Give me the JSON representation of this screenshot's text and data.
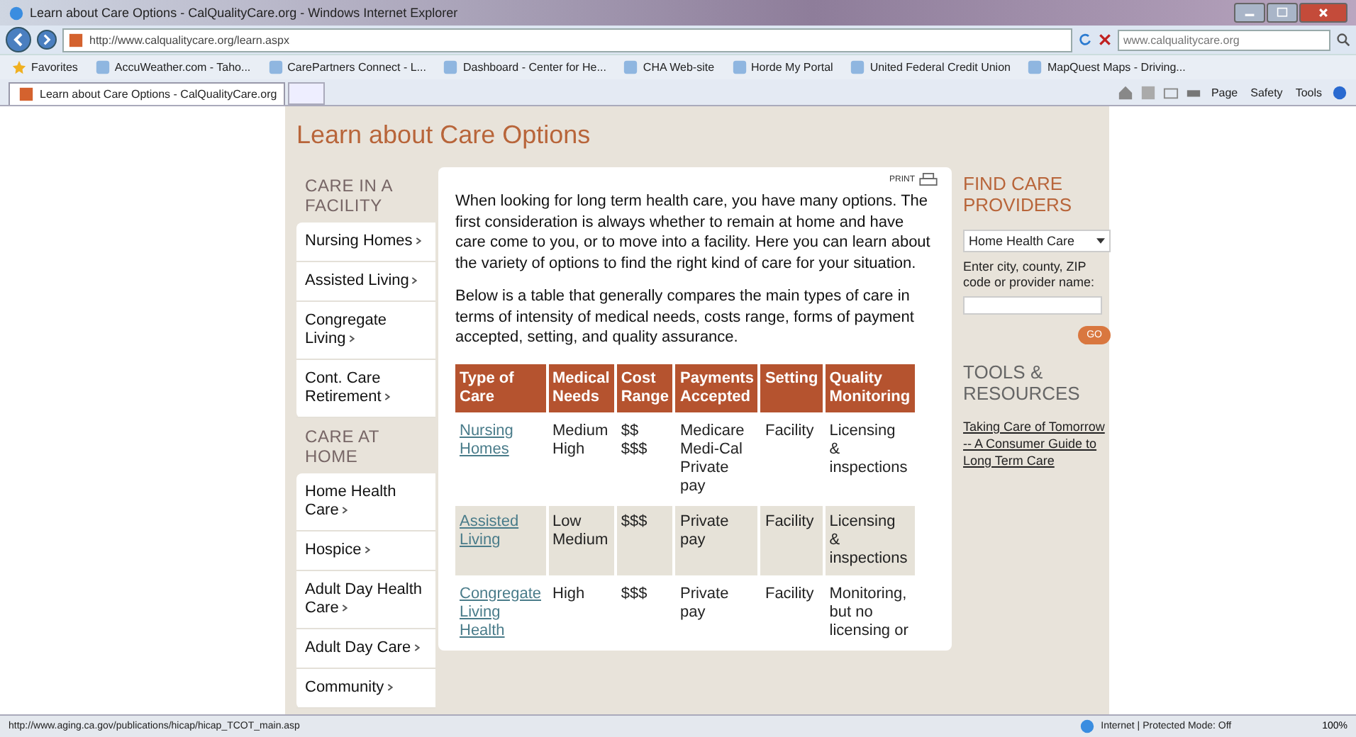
{
  "window": {
    "title": "Learn about Care Options - CalQualityCare.org - Windows Internet Explorer"
  },
  "address_bar": {
    "url": "http://www.calqualitycare.org/learn.aspx",
    "search_placeholder": "www.calqualitycare.org"
  },
  "favorites_bar": {
    "label": "Favorites",
    "items": [
      "AccuWeather.com - Taho...",
      "CarePartners Connect - L...",
      "Dashboard - Center for He...",
      "CHA Web-site",
      "Horde My Portal",
      "United Federal Credit Union",
      "MapQuest Maps - Driving..."
    ]
  },
  "tabs": [
    {
      "label": "Learn about Care Options - CalQualityCare.org",
      "selected": true
    }
  ],
  "command_bar": [
    "Page",
    "Safety",
    "Tools"
  ],
  "page": {
    "heading": "Learn about Care Options",
    "nav": [
      {
        "heading": "CARE IN A FACILITY",
        "items": [
          "Nursing Homes",
          "Assisted Living",
          "Congregate Living",
          "Cont. Care Retirement"
        ]
      },
      {
        "heading": "CARE AT HOME",
        "items": [
          "Home Health Care",
          "Hospice",
          "Adult Day Health Care",
          "Adult Day Care",
          "Community"
        ]
      }
    ],
    "print_label": "PRINT",
    "paragraphs": [
      "When looking for long term health care, you have many options. The first consideration is always whether to remain at home and have care come to you, or to move into a facility. Here you can learn about the variety of options to find the right kind of care for your situation.",
      "Below is a table that generally compares the main types of care in terms of intensity of medical needs, costs range, forms of payment accepted, setting, and quality assurance."
    ],
    "table": {
      "columns": [
        "Type of Care",
        "Medical Needs",
        "Cost Range",
        "Payments Accepted",
        "Setting",
        "Quality Monitoring"
      ],
      "rows": [
        {
          "type": "Nursing Homes",
          "medical": "Medium High",
          "cost": "$$ $$$",
          "payments": "Medicare Medi-Cal Private pay",
          "setting": "Facility",
          "quality": "Licensing & inspections"
        },
        {
          "type": "Assisted Living",
          "medical": "Low Medium",
          "cost": "$$$",
          "payments": "Private pay",
          "setting": "Facility",
          "quality": "Licensing & inspections"
        },
        {
          "type": "Congregate Living Health",
          "medical": "High",
          "cost": "$$$",
          "payments": "Private pay",
          "setting": "Facility",
          "quality": "Monitoring, but no licensing or"
        }
      ]
    },
    "find_care": {
      "heading": "FIND CARE PROVIDERS",
      "select": "Home Health Care",
      "field_label": "Enter city, county, ZIP code or provider name:",
      "button": "GO"
    },
    "tools": {
      "heading": "TOOLS & RESOURCES",
      "link": "Taking Care of Tomorrow -- A Consumer Guide to Long Term Care"
    }
  },
  "status_bar": {
    "url": "http://www.aging.ca.gov/publications/hicap/hicap_TCOT_main.asp",
    "zone": "Internet | Protected Mode: Off",
    "zoom": "100%"
  }
}
